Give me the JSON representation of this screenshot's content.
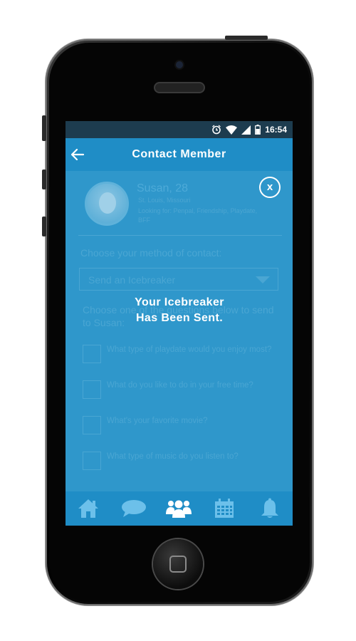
{
  "status_bar": {
    "time": "16:54"
  },
  "header": {
    "title": "Contact Member",
    "back_icon": "arrow-left-icon"
  },
  "member": {
    "name": "Susan, 28",
    "location": "St. Louis, Missouri",
    "looking_for": "Looking for: Penpal, Friendship, Playdate, BFF"
  },
  "contact": {
    "method_label": "Choose your method of contact:",
    "selected_method": "Send an Icebreaker",
    "choose_label": "Choose one of the questions below to send to Susan:",
    "questions": [
      "What type of playdate would you enjoy most?",
      "What do you like to do in your free time?",
      "What's your favorite movie?",
      "What type of music do you listen to?"
    ]
  },
  "overlay": {
    "close_label": "x",
    "message_line1": "Your Icebreaker",
    "message_line2": "Has Been Sent."
  },
  "nav": {
    "items": [
      {
        "icon": "home-icon"
      },
      {
        "icon": "chat-icon"
      },
      {
        "icon": "group-icon",
        "active": true
      },
      {
        "icon": "calendar-icon"
      },
      {
        "icon": "bell-icon"
      }
    ]
  },
  "colors": {
    "screen_bg": "#2f97cb",
    "header_bg": "#1f8dc6",
    "status_bg": "#1d3c4f",
    "faded_text": "#4aa6d3",
    "nav_icon": "#6cc0ea",
    "nav_icon_active": "#ffffff"
  }
}
